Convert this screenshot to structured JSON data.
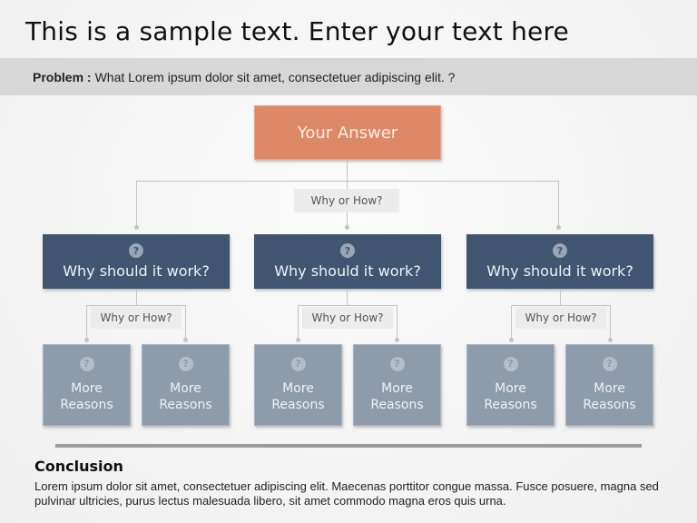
{
  "title": "This is a sample text. Enter your text here",
  "problem": {
    "label": "Problem :",
    "text": "What Lorem ipsum dolor sit amet,  consectetuer adipiscing elit. ?"
  },
  "answer": {
    "label": "Your Answer"
  },
  "connector_label": "Why or How?",
  "branches": [
    {
      "label": "Why should it work?",
      "sub_label": "Why or How?",
      "reasons": [
        {
          "line1": "More",
          "line2": "Reasons"
        },
        {
          "line1": "More",
          "line2": "Reasons"
        }
      ]
    },
    {
      "label": "Why should it work?",
      "sub_label": "Why or How?",
      "reasons": [
        {
          "line1": "More",
          "line2": "Reasons"
        },
        {
          "line1": "More",
          "line2": "Reasons"
        }
      ]
    },
    {
      "label": "Why should it work?",
      "sub_label": "Why or How?",
      "reasons": [
        {
          "line1": "More",
          "line2": "Reasons"
        },
        {
          "line1": "More",
          "line2": "Reasons"
        }
      ]
    }
  ],
  "question_icon_glyph": "?",
  "conclusion": {
    "title": "Conclusion",
    "text": "Lorem ipsum dolor sit amet, consectetuer adipiscing elit. Maecenas porttitor congue massa. Fusce posuere, magna sed pulvinar ultricies, purus lectus malesuada libero, sit amet commodo magna eros quis urna."
  },
  "colors": {
    "answer": "#dd8866",
    "why_box": "#3f5571",
    "reason_box": "#8d9baa",
    "problem_bar": "#d7d7d7"
  }
}
